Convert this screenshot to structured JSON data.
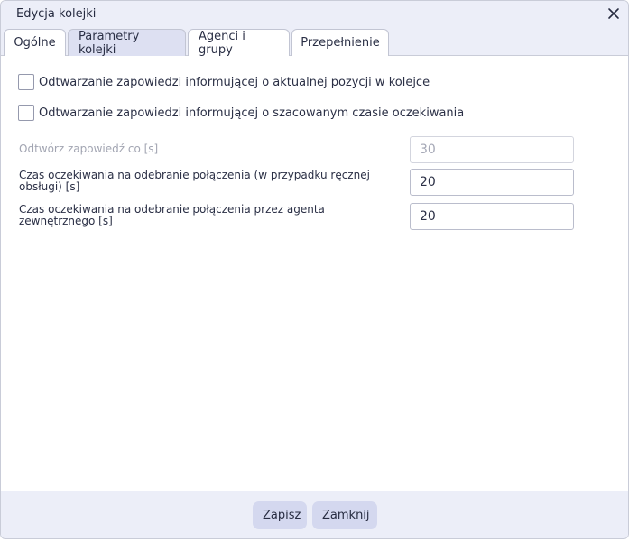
{
  "dialog": {
    "title": "Edycja kolejki",
    "close_icon": "close-icon"
  },
  "tabs": [
    {
      "label": "Ogólne",
      "active": false
    },
    {
      "label": "Parametry kolejki",
      "active": true
    },
    {
      "label": "Agenci i grupy",
      "active": false
    },
    {
      "label": "Przepełnienie",
      "active": false
    }
  ],
  "checkboxes": [
    {
      "label": "Odtwarzanie zapowiedzi informującej o aktualnej pozycji w kolejce",
      "checked": false
    },
    {
      "label": "Odtwarzanie zapowiedzi informującej o szacowanym czasie oczekiwania",
      "checked": false
    }
  ],
  "fields": [
    {
      "label": "Odtwórz zapowiedź co [s]",
      "value": "30",
      "disabled": true
    },
    {
      "label": "Czas oczekiwania na odebranie połączenia (w przypadku ręcznej obsługi) [s]",
      "value": "20",
      "disabled": false
    },
    {
      "label": "Czas oczekiwania na odebranie połączenia przez agenta zewnętrznego [s]",
      "value": "20",
      "disabled": false
    }
  ],
  "footer": {
    "save_label": "Zapisz",
    "close_label": "Zamknij"
  },
  "colors": {
    "header_bg": "#eceef8",
    "active_tab": "#dde0f2",
    "button_bg": "#d4d8ef",
    "text": "#2a2f45"
  }
}
